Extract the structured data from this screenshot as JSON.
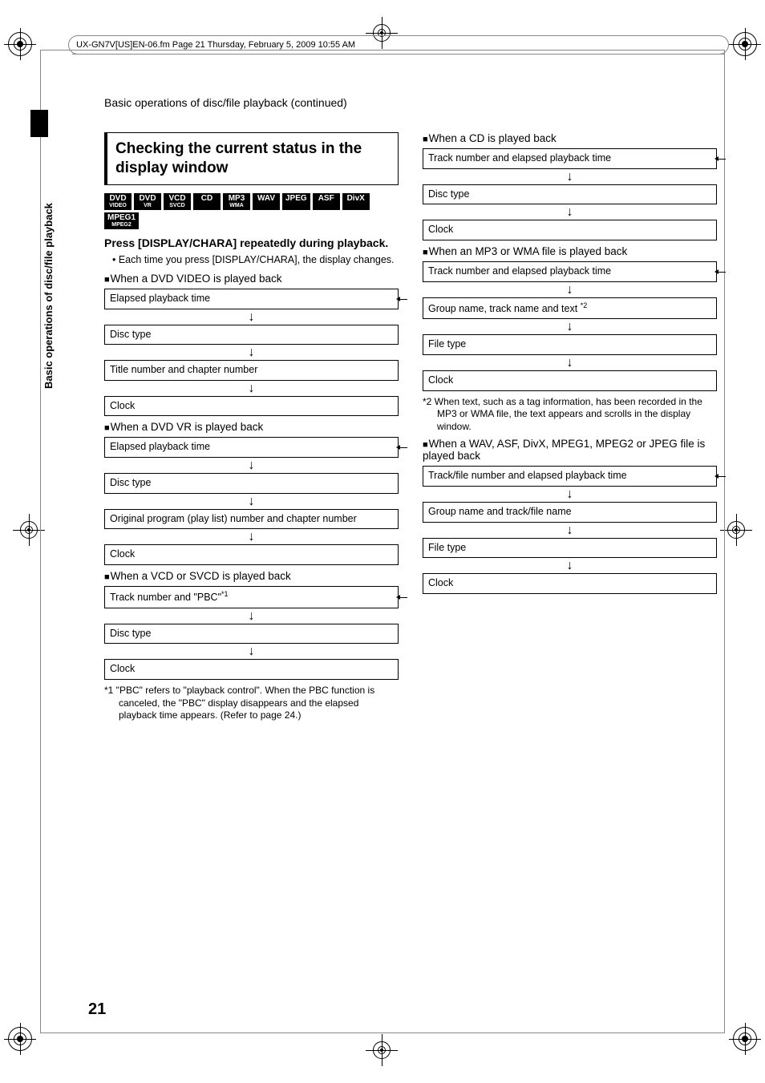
{
  "header": "UX-GN7V[US]EN-06.fm  Page 21  Thursday, February 5, 2009  10:55 AM",
  "section_header": "Basic operations of disc/file playback (continued)",
  "sidebar": "Basic operations of disc/file playback",
  "title": "Checking the current status in the display window",
  "badges": [
    {
      "main": "DVD",
      "sub": "VIDEO"
    },
    {
      "main": "DVD",
      "sub": "VR"
    },
    {
      "main": "VCD",
      "sub": "SVCD"
    },
    {
      "main": "CD",
      "sub": ""
    },
    {
      "main": "MP3",
      "sub": "WMA"
    },
    {
      "main": "WAV",
      "sub": ""
    },
    {
      "main": "JPEG",
      "sub": ""
    },
    {
      "main": "ASF",
      "sub": ""
    },
    {
      "main": "DivX",
      "sub": ""
    },
    {
      "main": "MPEG1",
      "sub": "MPEG2"
    }
  ],
  "instruction": "Press [DISPLAY/CHARA] repeatedly during playback.",
  "bullet1": "•  Each time you press [DISPLAY/CHARA], the display changes.",
  "flows": {
    "dvd_video": {
      "heading": "When a DVD VIDEO is played back",
      "steps": [
        "Elapsed playback time",
        "Disc type",
        "Title number and chapter number",
        "Clock"
      ]
    },
    "dvd_vr": {
      "heading": "When a DVD VR is played back",
      "steps": [
        "Elapsed playback time",
        "Disc type",
        "Original program (play list) number and chapter number",
        "Clock"
      ]
    },
    "vcd": {
      "heading": "When a VCD or SVCD is played back",
      "steps_html": [
        "Track number and \"PBC\"",
        "Disc type",
        "Clock"
      ],
      "sup1": "*1"
    },
    "cd": {
      "heading": "When a CD is played back",
      "steps": [
        "Track number and elapsed playback time",
        "Disc type",
        "Clock"
      ]
    },
    "mp3": {
      "heading": "When an MP3 or WMA file is played back",
      "steps": [
        "Track number and elapsed playback time",
        "Group name, track name and text ",
        "File type",
        "Clock"
      ],
      "sup2": "*2"
    },
    "wav": {
      "heading": "When a WAV, ASF, DivX, MPEG1, MPEG2 or JPEG file is played back",
      "steps": [
        "Track/file number and elapsed playback time",
        "Group name and track/file name",
        "File type",
        "Clock"
      ]
    }
  },
  "footnote1": "*1 \"PBC\" refers to \"playback control\". When the PBC function is canceled, the \"PBC\" display disappears and the elapsed playback time appears. (Refer to page 24.)",
  "footnote2": "*2 When text, such as a tag information, has been recorded in the MP3 or WMA file, the text appears and scrolls in the display window.",
  "page_number": "21"
}
